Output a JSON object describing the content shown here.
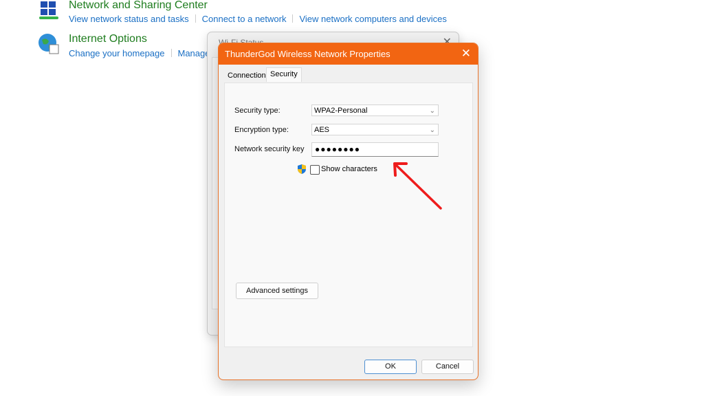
{
  "control_panel": {
    "network_sharing": {
      "title": "Network and Sharing Center",
      "links": [
        "View network status and tasks",
        "Connect to a network",
        "View network computers and devices"
      ]
    },
    "internet_options": {
      "title": "Internet Options",
      "links": [
        "Change your homepage",
        "Manage b"
      ]
    }
  },
  "wifi_status": {
    "title": "Wi-Fi Status",
    "close": "✕"
  },
  "properties": {
    "title": "ThunderGod Wireless Network Properties",
    "close": "✕",
    "tabs": [
      {
        "label": "Connection"
      },
      {
        "label": "Security",
        "active": true
      }
    ],
    "security_type": {
      "label": "Security type:",
      "value": "WPA2-Personal"
    },
    "encryption_type": {
      "label": "Encryption type:",
      "value": "AES"
    },
    "network_key": {
      "label": "Network security key",
      "value": "●●●●●●●●"
    },
    "show_characters": {
      "label": "Show characters",
      "checked": false
    },
    "advanced": "Advanced settings",
    "ok": "OK",
    "cancel": "Cancel"
  },
  "annotation": {
    "color": "#ee1c1c",
    "icon": "red-arrow"
  }
}
